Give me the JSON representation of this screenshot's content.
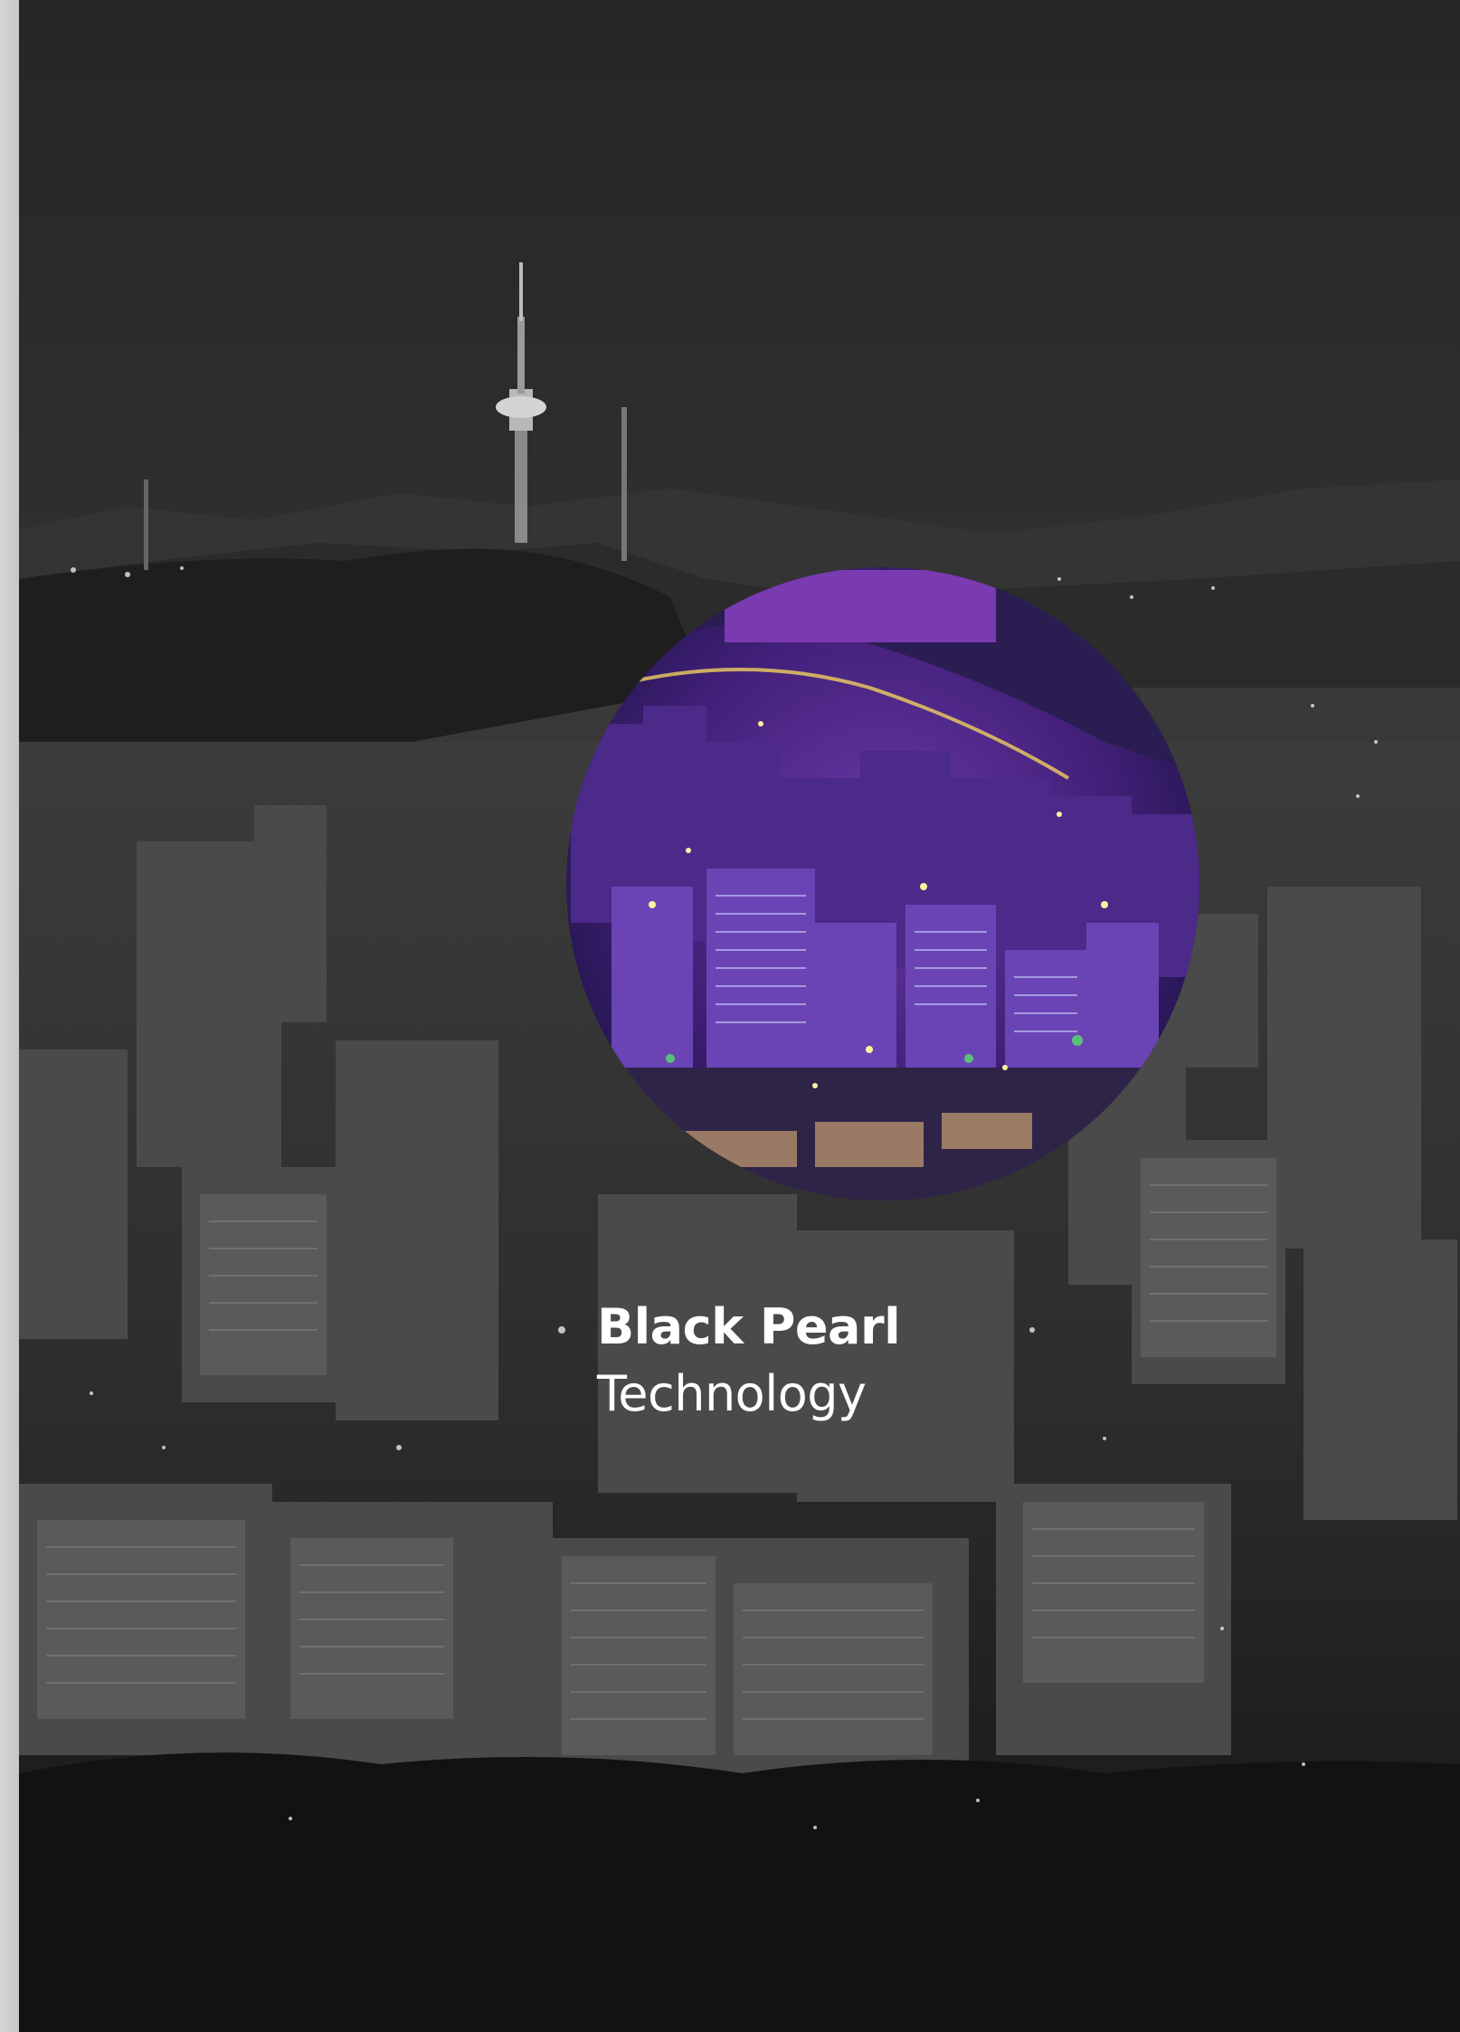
{
  "cover": {
    "title": "Black Pearl",
    "subtitle": "Technology"
  },
  "colors": {
    "sky": "#2a2a2a",
    "city_gray": "#3a3a3a",
    "spine": "#cfd2d0",
    "circle_purple": "#5a2a8c",
    "circle_deep": "#1c1446",
    "text": "#ffffff"
  }
}
